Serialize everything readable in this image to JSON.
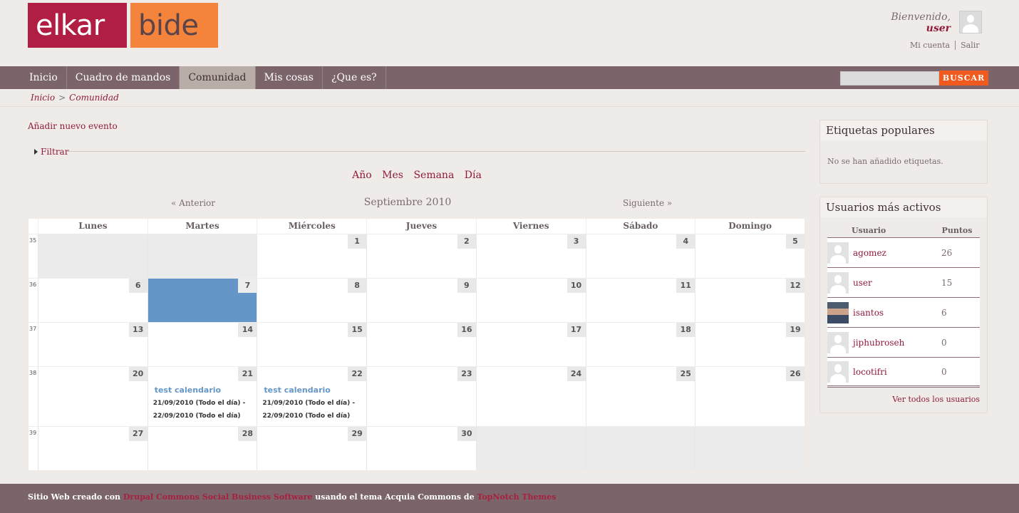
{
  "logo": {
    "part1": "elkar",
    "part2": "bide"
  },
  "user_area": {
    "welcome": "Bienvenido,",
    "username": "user",
    "my_account": "Mi cuenta",
    "logout": "Salir"
  },
  "nav": {
    "items": [
      "Inicio",
      "Cuadro de mandos",
      "Comunidad",
      "Mis cosas",
      "¿Que es?"
    ],
    "active": "Comunidad"
  },
  "search": {
    "button": "BUSCAR",
    "placeholder": ""
  },
  "breadcrumb": {
    "items": [
      "Inicio",
      "Comunidad"
    ],
    "separator": ">"
  },
  "main": {
    "add_event": "Añadir nuevo evento",
    "filter": "Filtrar",
    "view_tabs": [
      "Año",
      "Mes",
      "Semana",
      "Día"
    ],
    "prev": "« Anterior",
    "month": "Septiembre 2010",
    "next": "Siguiente »"
  },
  "calendar": {
    "day_names": [
      "Lunes",
      "Martes",
      "Miércoles",
      "Jueves",
      "Viernes",
      "Sábado",
      "Domingo"
    ],
    "weeks": [
      {
        "number": "35",
        "days": [
          "",
          "",
          "1",
          "2",
          "3",
          "4",
          "5"
        ]
      },
      {
        "number": "36",
        "days": [
          "6",
          "7",
          "8",
          "9",
          "10",
          "11",
          "12"
        ]
      },
      {
        "number": "37",
        "days": [
          "13",
          "14",
          "15",
          "16",
          "17",
          "18",
          "19"
        ]
      },
      {
        "number": "38",
        "days": [
          "20",
          "21",
          "22",
          "23",
          "24",
          "25",
          "26"
        ]
      },
      {
        "number": "39",
        "days": [
          "27",
          "28",
          "29",
          "30",
          "",
          "",
          ""
        ]
      }
    ],
    "today": "7",
    "events": [
      {
        "day": "21",
        "title": "test calendario",
        "line1": "21/09/2010 (Todo el día) -",
        "line2": "22/09/2010 (Todo el día)"
      },
      {
        "day": "22",
        "title": "test calendario",
        "line1": "21/09/2010 (Todo el día) -",
        "line2": "22/09/2010 (Todo el día)"
      }
    ]
  },
  "sidebar": {
    "tags": {
      "title": "Etiquetas populares",
      "empty": "No se han añadido etiquetas."
    },
    "users": {
      "title": "Usuarios más activos",
      "col_user": "Usuario",
      "col_points": "Puntos",
      "rows": [
        {
          "name": "agomez",
          "points": "26",
          "photo": false
        },
        {
          "name": "user",
          "points": "15",
          "photo": false
        },
        {
          "name": "isantos",
          "points": "6",
          "photo": true
        },
        {
          "name": "jiphubroseh",
          "points": "0",
          "photo": false
        },
        {
          "name": "locotifri",
          "points": "0",
          "photo": false
        }
      ],
      "see_all": "Ver todos los usuarios"
    }
  },
  "footer": {
    "text1": "Sitio Web creado con ",
    "link1": "Drupal Commons Social Business Software",
    "text2": " usando el tema Acquia Commons de ",
    "link2": "TopNotch Themes"
  },
  "colors": {
    "brand": "#8f1b3a",
    "nav_bg": "#7b656a",
    "search_button": "#f05a1e",
    "today": "#6497c7"
  }
}
